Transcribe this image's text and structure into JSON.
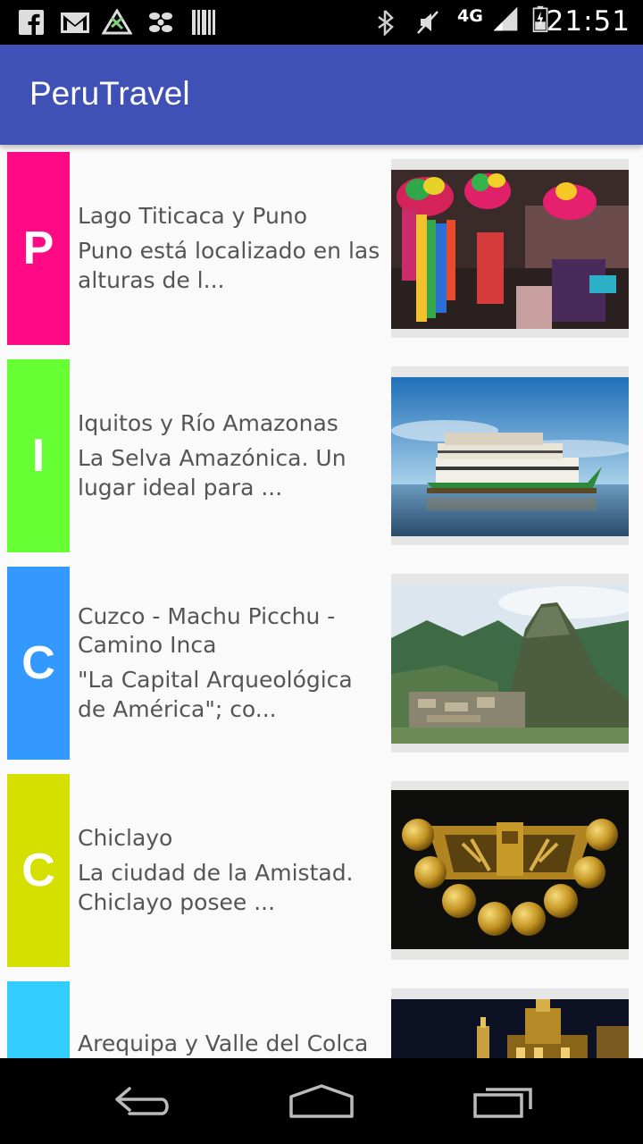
{
  "status_bar": {
    "time": "21:51",
    "network": "4G",
    "notification_icons": [
      "facebook-icon",
      "gmail-icon",
      "app-icon",
      "fan-icon",
      "barcode-icon"
    ],
    "system_icons": [
      "bluetooth-icon",
      "mute-icon",
      "signal-icon",
      "battery-icon"
    ]
  },
  "app_bar": {
    "title": "PeruTravel",
    "color": "#3f51b5"
  },
  "list": [
    {
      "letter": "P",
      "color": "#ff0a84",
      "title": "Lago Titicaca y Puno",
      "description": "Puno está localizado en las alturas de l...",
      "image": "puno-festival-photo"
    },
    {
      "letter": "I",
      "color": "#66ff33",
      "title": "Iquitos y Río Amazonas",
      "description": "La Selva Amazónica. Un lugar ideal para ...",
      "image": "amazon-riverboat-photo"
    },
    {
      "letter": "C",
      "color": "#3399ff",
      "title": "Cuzco - Machu Picchu - Camino Inca",
      "description": "\"La Capital Arqueológica de América\"; co...",
      "image": "machu-picchu-photo"
    },
    {
      "letter": "C",
      "color": "#d6e000",
      "title": "Chiclayo",
      "description": "La ciudad de la Amistad. Chiclayo posee ...",
      "image": "gold-ornament-photo"
    },
    {
      "letter": "",
      "color": "#33ccff",
      "title": "Arequipa y Valle del Colca",
      "description": "",
      "image": "arequipa-cathedral-photo"
    }
  ],
  "nav_bar": {
    "buttons": [
      "back-icon",
      "home-icon",
      "recents-icon"
    ]
  }
}
